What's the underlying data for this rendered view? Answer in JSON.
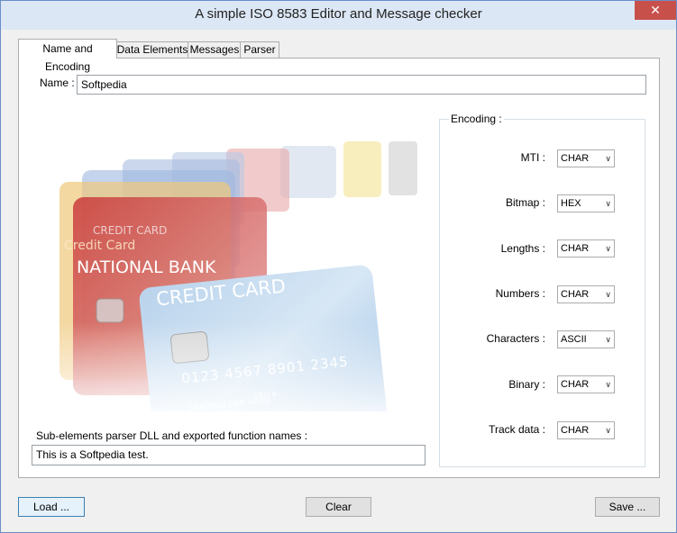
{
  "window": {
    "title": "A simple ISO 8583 Editor and Message checker",
    "close_glyph": "✕"
  },
  "tabs": [
    {
      "label": "Name and Encoding"
    },
    {
      "label": "Data Elements"
    },
    {
      "label": "Messages"
    },
    {
      "label": "Parser"
    }
  ],
  "name": {
    "label": "Name :",
    "value": "Softpedia"
  },
  "artwork": {
    "cards": [
      "CREDIT CARD",
      "NATIONAL BANK",
      "CREDIT CARD",
      "Credit Card"
    ],
    "number": "0123 4567 8901 2345",
    "holder": "CARDHOLDER NAME",
    "expiry": "08/14"
  },
  "encoding": {
    "title": "Encoding :",
    "fields": [
      {
        "label": "MTI :",
        "value": "CHAR"
      },
      {
        "label": "Bitmap :",
        "value": "HEX"
      },
      {
        "label": "Lengths :",
        "value": "CHAR"
      },
      {
        "label": "Numbers :",
        "value": "CHAR"
      },
      {
        "label": "Characters :",
        "value": "ASCII"
      },
      {
        "label": "Binary :",
        "value": "CHAR"
      },
      {
        "label": "Track data :",
        "value": "CHAR"
      }
    ]
  },
  "parser": {
    "label": "Sub-elements parser DLL and exported function names :",
    "value": "This is a Softpedia test."
  },
  "buttons": {
    "load": "Load ...",
    "clear": "Clear",
    "save": "Save ..."
  }
}
